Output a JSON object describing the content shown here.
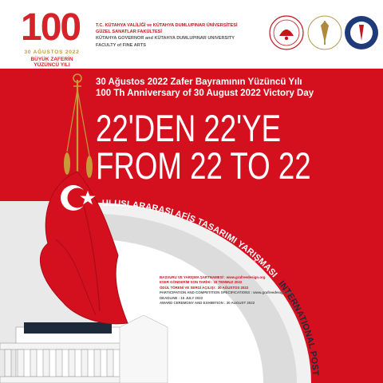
{
  "logo": {
    "number": "100",
    "date_line": "30 AĞUSTOS 2022",
    "tagline": "BÜYÜK ZAFERİN YÜZÜNCÜ YILI"
  },
  "header": {
    "line1": "T.C. KÜTAHYA VALİLİĞİ ve KÜTAHYA DUMLUPINAR ÜNİVERSİTESİ",
    "line2": "GÜZEL SANATLAR FAKÜLTESİ",
    "line3": "KÜTAHYA GOVERNOR  and KÜTAHYA DUMLUPINAR UNIVERSITY",
    "line4": "FACULTY of FINE ARTS"
  },
  "subtitle_tr": "30 Ağustos 2022 Zafer Bayramının Yüzüncü Yılı",
  "subtitle_en": "100 Th Anniversary of 30 August 2022 Victory Day",
  "headline_tr": "22'DEN 22'YE",
  "headline_en": "FROM 22 TO 22",
  "competition_tr": "ULUSLARARASI AFİŞ TASARIMI YARIŞMASI",
  "competition_en": "INTERNATIONAL POSTER COMPETITION",
  "details": [
    "BAŞVURU VE  YARIŞMA  ŞARTNAMESİ : www.grafreedesign.org",
    "ESER GÖNDERİM SON TARİHİ : 15 TEMMUZ 2022",
    "ÖDÜL TÖRENİ VE SERGİ AÇILIŞI : 30 AĞUSTOS 2022",
    "PARTICIPATION AND COMPETITION SPECIFICATIONS : www.grafreedesign.org",
    "DEADLINE : 15 JULY 2022",
    "AWARD CEREMONY AND EXHIBITION : 30 AUGUST 2022"
  ],
  "colors": {
    "red": "#d4101f",
    "white": "#ffffff",
    "grey": "#c8c8c8",
    "dark": "#1e2a3a",
    "gold": "#c79a3a"
  }
}
